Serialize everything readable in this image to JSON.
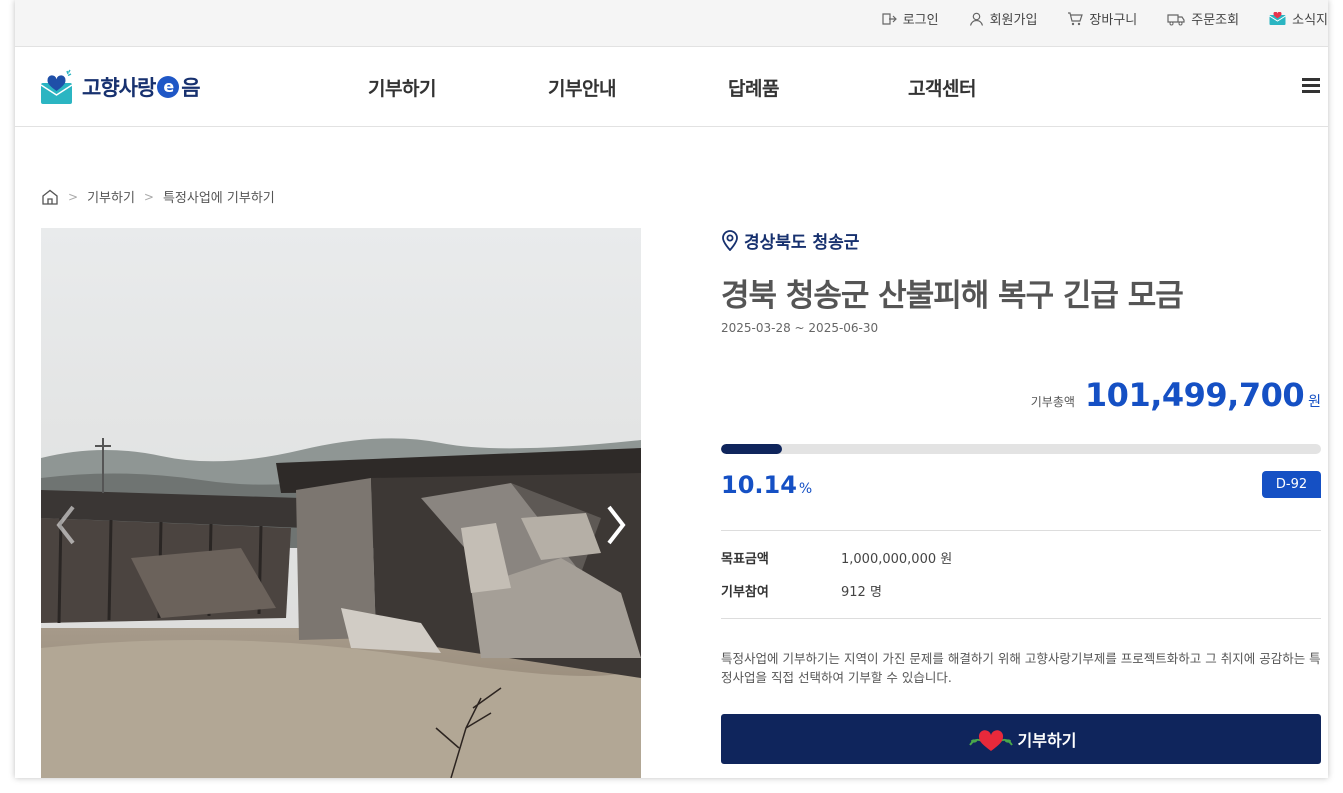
{
  "util_menu": {
    "login": "로그인",
    "signup": "회원가입",
    "cart": "장바구니",
    "order": "주문조회",
    "news": "소식지"
  },
  "logo": {
    "part1": "고향사랑",
    "e": "e",
    "part2": "음"
  },
  "nav": [
    "기부하기",
    "기부안내",
    "답례품",
    "고객센터"
  ],
  "breadcrumb": [
    "기부하기",
    "특정사업에 기부하기"
  ],
  "project": {
    "region": "경상북도 청송군",
    "title": "경북 청송군 산불피해 복구 긴급 모금",
    "period": "2025-03-28 ~ 2025-06-30",
    "total_label": "기부총액",
    "total_value": "101,499,700",
    "total_unit": "원",
    "progress_percent": 10.14,
    "percent_value": "10.14",
    "percent_unit": "%",
    "dday": "D-92",
    "goal_label": "목표금액",
    "goal_value": "1,000,000,000 원",
    "participants_label": "기부참여",
    "participants_value": "912 명",
    "description": "특정사업에 기부하기는 지역이 가진 문제를 해결하기 위해 고향사랑기부제를 프로젝트화하고 그 취지에 공감하는 특정사업을 직접 선택하여 기부할 수 있습니다.",
    "donate_label": "기부하기"
  },
  "colors": {
    "navy": "#0f255c",
    "accent_blue": "#1550c4",
    "logo_navy": "#17316f"
  }
}
